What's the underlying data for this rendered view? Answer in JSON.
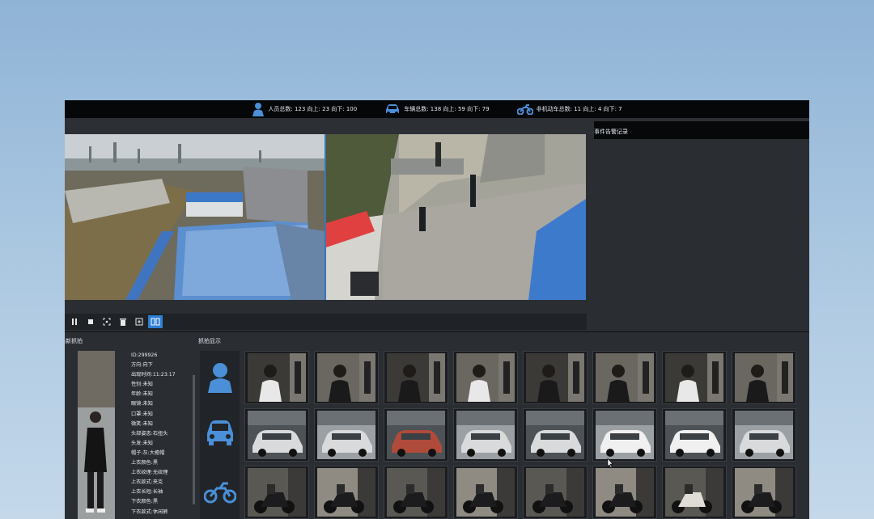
{
  "topbar": {
    "person_stats": "人员总数: 123 向上: 23 向下: 100",
    "vehicle_stats": "车辆总数: 138 向上: 59 向下: 79",
    "nonmotor_stats": "非机动车总数: 11 向上: 4 向下: 7"
  },
  "event_panel": {
    "title": "事件告警记录"
  },
  "sections": {
    "latest_capture": "最新抓拍",
    "capture_display": "抓拍显示"
  },
  "attributes": [
    "ID:299926",
    "方向:向下",
    "出现时间:11:23:17",
    "性别:未知",
    "年龄:未知",
    "眼镜:未知",
    "口罩:未知",
    "微笑:未知",
    "头部姿态:右扭头",
    "头发:未知",
    "帽子:灰:大檐帽",
    "上衣颜色:黑",
    "上衣纹理:无纹理",
    "上衣款式:夹克",
    "上衣长短:长袖",
    "下衣颜色:黑",
    "下衣款式:休闲裤"
  ],
  "controls": [
    "pause-icon",
    "stop-icon",
    "capture-icon",
    "delete-icon",
    "export-icon",
    "split-view-icon"
  ],
  "icons": {
    "person": "person-icon",
    "vehicle": "car-icon",
    "nonmotor": "motorcycle-icon"
  },
  "colors": {
    "accent": "#2d7fd2",
    "topbar": "#060708",
    "panel": "#2a2e33",
    "icon_blue": "#4a8fd8"
  }
}
